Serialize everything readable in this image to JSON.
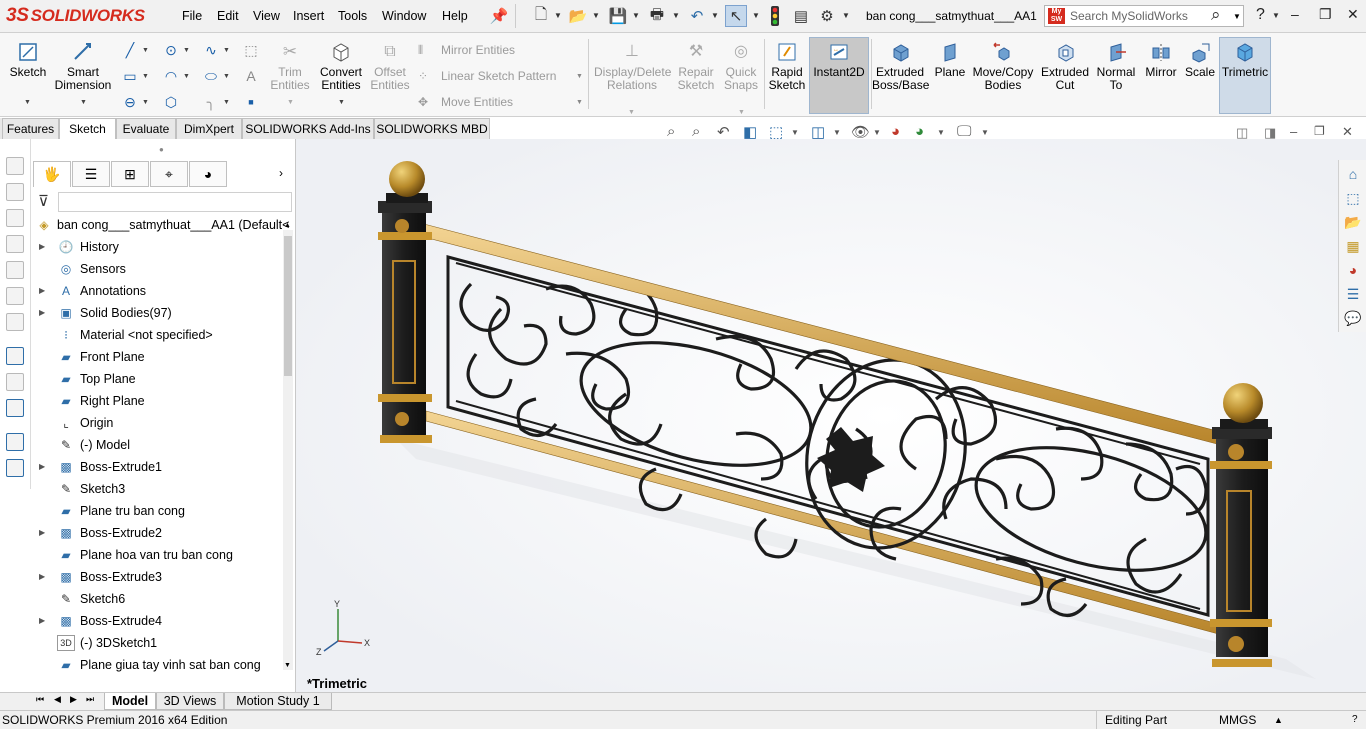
{
  "app": {
    "logo_text": "SOLIDWORKS",
    "logo_mark": "3S"
  },
  "menu": [
    "File",
    "Edit",
    "View",
    "Insert",
    "Tools",
    "Window",
    "Help"
  ],
  "document_title": "ban cong___satmythuat___AA1",
  "search": {
    "placeholder": "Search MySolidWorks",
    "badge": "My SW"
  },
  "window_controls": {
    "help": "?",
    "minimize": "–",
    "restore": "❐",
    "close": "✕"
  },
  "command_manager": {
    "sketch": "Sketch",
    "smart_dimension": [
      "Smart",
      "Dimension"
    ],
    "trim_entities": [
      "Trim",
      "Entities"
    ],
    "convert_entities": [
      "Convert",
      "Entities"
    ],
    "offset_entities": [
      "Offset",
      "Entities"
    ],
    "mirror_entities": "Mirror Entities",
    "linear_sketch_pattern": "Linear Sketch Pattern",
    "move_entities": "Move Entities",
    "display_delete_relations": [
      "Display/Delete",
      "Relations"
    ],
    "repair_sketch": [
      "Repair",
      "Sketch"
    ],
    "quick_snaps": [
      "Quick",
      "Snaps"
    ],
    "rapid_sketch": [
      "Rapid",
      "Sketch"
    ],
    "instant2d": "Instant2D",
    "extruded_boss": [
      "Extruded",
      "Boss/Base"
    ],
    "plane": "Plane",
    "move_copy_bodies": [
      "Move/Copy",
      "Bodies"
    ],
    "extruded_cut": [
      "Extruded",
      "Cut"
    ],
    "normal_to": [
      "Normal",
      "To"
    ],
    "mirror": "Mirror",
    "scale": "Scale",
    "trimetric": "Trimetric"
  },
  "tabs": [
    "Features",
    "Sketch",
    "Evaluate",
    "DimXpert",
    "SOLIDWORKS Add-Ins",
    "SOLIDWORKS MBD"
  ],
  "active_tab": "Sketch",
  "feature_tree": {
    "root": "ban cong___satmythuat___AA1  (Default<",
    "items": [
      {
        "label": "History",
        "expandable": true,
        "icon": "history-icon"
      },
      {
        "label": "Sensors",
        "expandable": false,
        "icon": "sensors-icon"
      },
      {
        "label": "Annotations",
        "expandable": true,
        "icon": "annotations-icon"
      },
      {
        "label": "Solid Bodies(97)",
        "expandable": true,
        "icon": "solid-bodies-icon"
      },
      {
        "label": "Material <not specified>",
        "expandable": false,
        "icon": "material-icon"
      },
      {
        "label": "Front Plane",
        "expandable": false,
        "icon": "plane-icon"
      },
      {
        "label": "Top Plane",
        "expandable": false,
        "icon": "plane-icon"
      },
      {
        "label": "Right Plane",
        "expandable": false,
        "icon": "plane-icon"
      },
      {
        "label": "Origin",
        "expandable": false,
        "icon": "origin-icon"
      },
      {
        "label": "(-) Model",
        "expandable": false,
        "icon": "sketch-icon"
      },
      {
        "label": "Boss-Extrude1",
        "expandable": true,
        "icon": "extrude-icon"
      },
      {
        "label": "Sketch3",
        "expandable": false,
        "icon": "sketch-icon"
      },
      {
        "label": "Plane tru ban cong",
        "expandable": false,
        "icon": "plane-icon"
      },
      {
        "label": "Boss-Extrude2",
        "expandable": true,
        "icon": "extrude-icon"
      },
      {
        "label": "Plane hoa van tru ban cong",
        "expandable": false,
        "icon": "plane-icon"
      },
      {
        "label": "Boss-Extrude3",
        "expandable": true,
        "icon": "extrude-icon"
      },
      {
        "label": "Sketch6",
        "expandable": false,
        "icon": "sketch-icon"
      },
      {
        "label": "Boss-Extrude4",
        "expandable": true,
        "icon": "extrude-icon"
      },
      {
        "label": "(-) 3DSketch1",
        "expandable": false,
        "icon": "3dsketch-icon"
      },
      {
        "label": "Plane giua tay vinh sat ban cong",
        "expandable": false,
        "icon": "plane-icon"
      }
    ]
  },
  "viewport": {
    "view_label": "*Trimetric",
    "triad": {
      "x": "X",
      "y": "Y",
      "z": "Z"
    }
  },
  "bottom_tabs": [
    "Model",
    "3D Views",
    "Motion Study 1"
  ],
  "active_bottom_tab": "Model",
  "status": {
    "edition": "SOLIDWORKS Premium 2016 x64 Edition",
    "mode": "Editing Part",
    "units": "MMGS"
  },
  "colors": {
    "brand": "#d52b1e",
    "accent": "#2f6ea8",
    "gold": "#c9962e",
    "iron": "#1c1c1c"
  }
}
